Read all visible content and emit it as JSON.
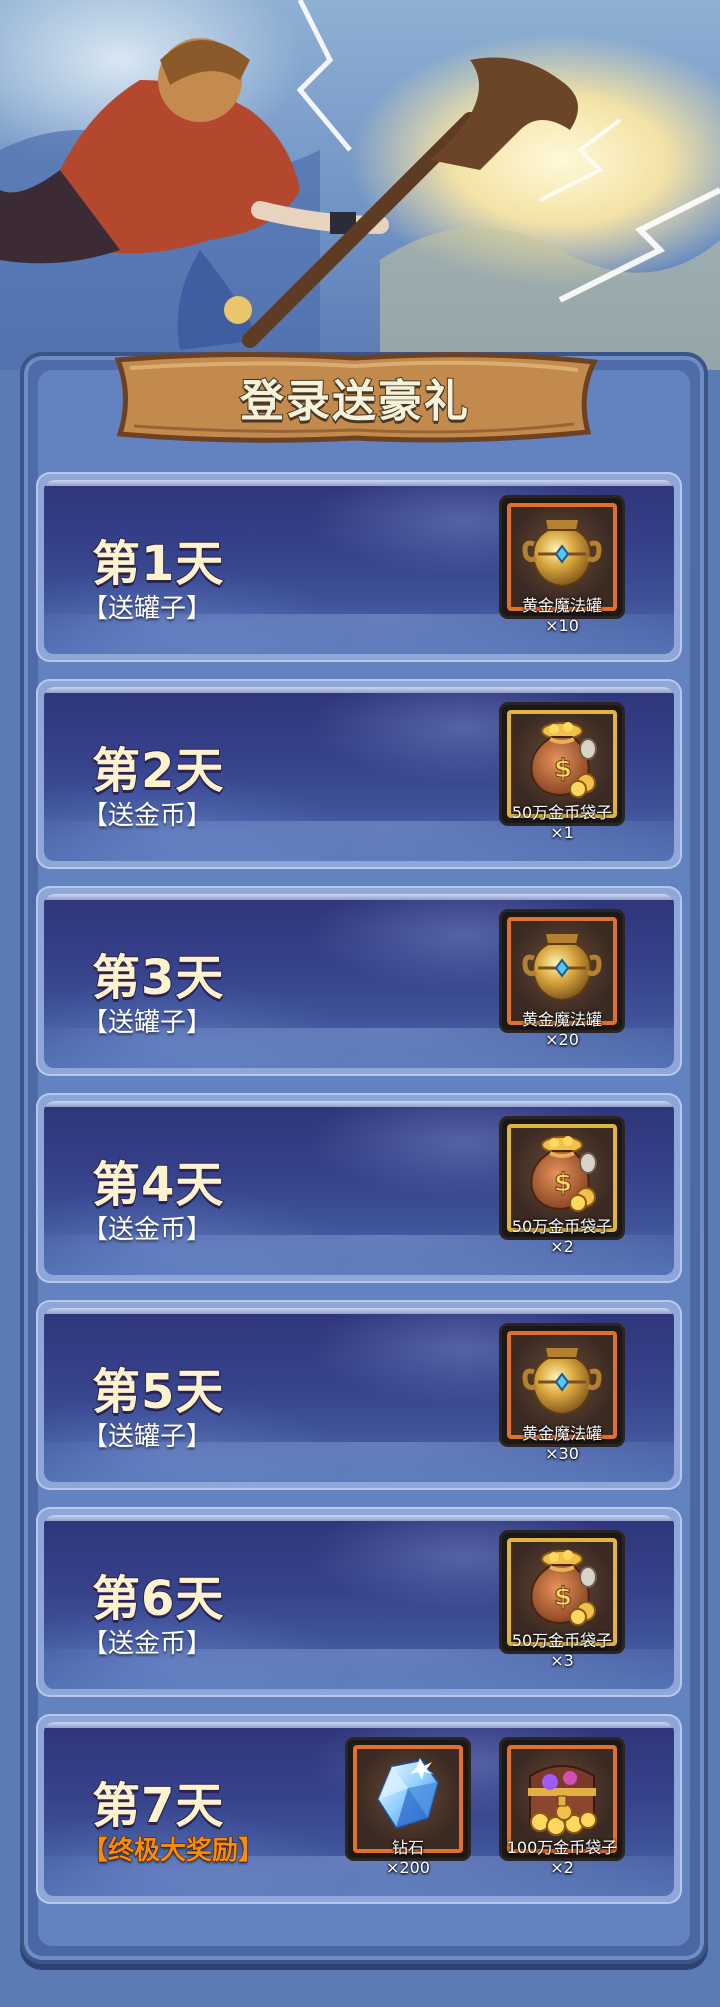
{
  "page_title": "登录送豪礼",
  "days": [
    {
      "title": "第1天",
      "subtitle": "【送罐子】",
      "special": false,
      "rewards": [
        {
          "icon": "golden-jar-icon",
          "frame": "orange",
          "name": "黄金魔法罐",
          "qty": "×10"
        }
      ]
    },
    {
      "title": "第2天",
      "subtitle": "【送金币】",
      "special": false,
      "rewards": [
        {
          "icon": "coin-bag-icon",
          "frame": "gold",
          "name": "50万金币袋子",
          "qty": "×1"
        }
      ]
    },
    {
      "title": "第3天",
      "subtitle": "【送罐子】",
      "special": false,
      "rewards": [
        {
          "icon": "golden-jar-icon",
          "frame": "orange",
          "name": "黄金魔法罐",
          "qty": "×20"
        }
      ]
    },
    {
      "title": "第4天",
      "subtitle": "【送金币】",
      "special": false,
      "rewards": [
        {
          "icon": "coin-bag-icon",
          "frame": "gold",
          "name": "50万金币袋子",
          "qty": "×2"
        }
      ]
    },
    {
      "title": "第5天",
      "subtitle": "【送罐子】",
      "special": false,
      "rewards": [
        {
          "icon": "golden-jar-icon",
          "frame": "orange",
          "name": "黄金魔法罐",
          "qty": "×30"
        }
      ]
    },
    {
      "title": "第6天",
      "subtitle": "【送金币】",
      "special": false,
      "rewards": [
        {
          "icon": "coin-bag-icon",
          "frame": "gold",
          "name": "50万金币袋子",
          "qty": "×3"
        }
      ]
    },
    {
      "title": "第7天",
      "subtitle": "【终极大奖励】",
      "special": true,
      "rewards": [
        {
          "icon": "diamond-icon",
          "frame": "orange",
          "name": "钻石",
          "qty": "×200"
        },
        {
          "icon": "treasure-chest-icon",
          "frame": "orange",
          "name": "100万金币袋子",
          "qty": "×2"
        }
      ]
    }
  ],
  "colors": {
    "special_subtitle": "#ff8a00",
    "title_text": "#fff3cf",
    "orange_frame": "#e0702b",
    "gold_frame": "#e2b341"
  }
}
